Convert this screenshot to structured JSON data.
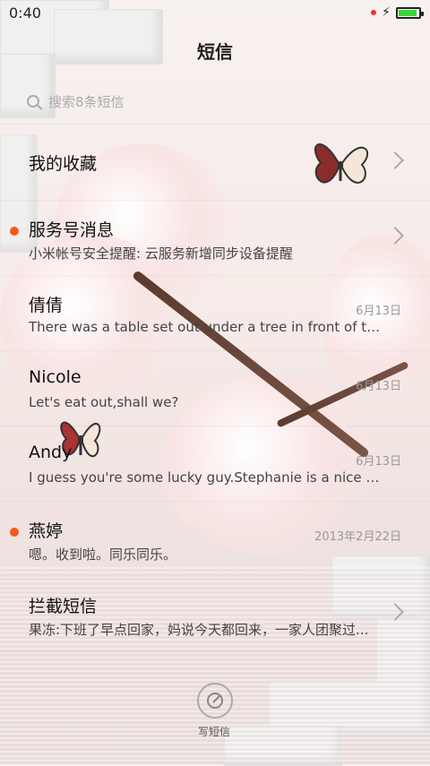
{
  "status_bar": {
    "time": "0:40",
    "battery_level": 0.9,
    "battery_color": "#39d639"
  },
  "header": {
    "title": "短信"
  },
  "search": {
    "placeholder": "搜索8条短信"
  },
  "threads": [
    {
      "name": "我的收藏",
      "preview": "",
      "date": "",
      "has_chevron": true,
      "unread": false
    },
    {
      "name": "服务号消息",
      "preview": "小米帐号安全提醒: 云服务新增同步设备提醒",
      "date": "",
      "has_chevron": true,
      "unread": true
    },
    {
      "name": "倩倩",
      "preview": "There was a table set out under a tree in front of the ho...",
      "date": "6月13日",
      "has_chevron": false,
      "unread": false
    },
    {
      "name": "Nicole",
      "preview": "Let's eat out,shall we?",
      "date": "6月13日",
      "has_chevron": false,
      "unread": false
    },
    {
      "name": "Andy",
      "preview": "I guess you're some lucky guy.Stephanie is a nice girl.",
      "date": "6月13日",
      "has_chevron": false,
      "unread": false
    },
    {
      "name": "燕婷",
      "preview": "嗯。收到啦。同乐同乐。",
      "date": "2013年2月22日",
      "has_chevron": false,
      "unread": true
    },
    {
      "name": "拦截短信",
      "preview": "果冻:下班了早点回家，妈说今天都回来，一家人团聚过...",
      "date": "",
      "has_chevron": true,
      "unread": false
    }
  ],
  "compose": {
    "label": "写短信",
    "icon": "compose-icon"
  },
  "colors": {
    "unread": "#f25a1a",
    "accent": "#39d639"
  }
}
